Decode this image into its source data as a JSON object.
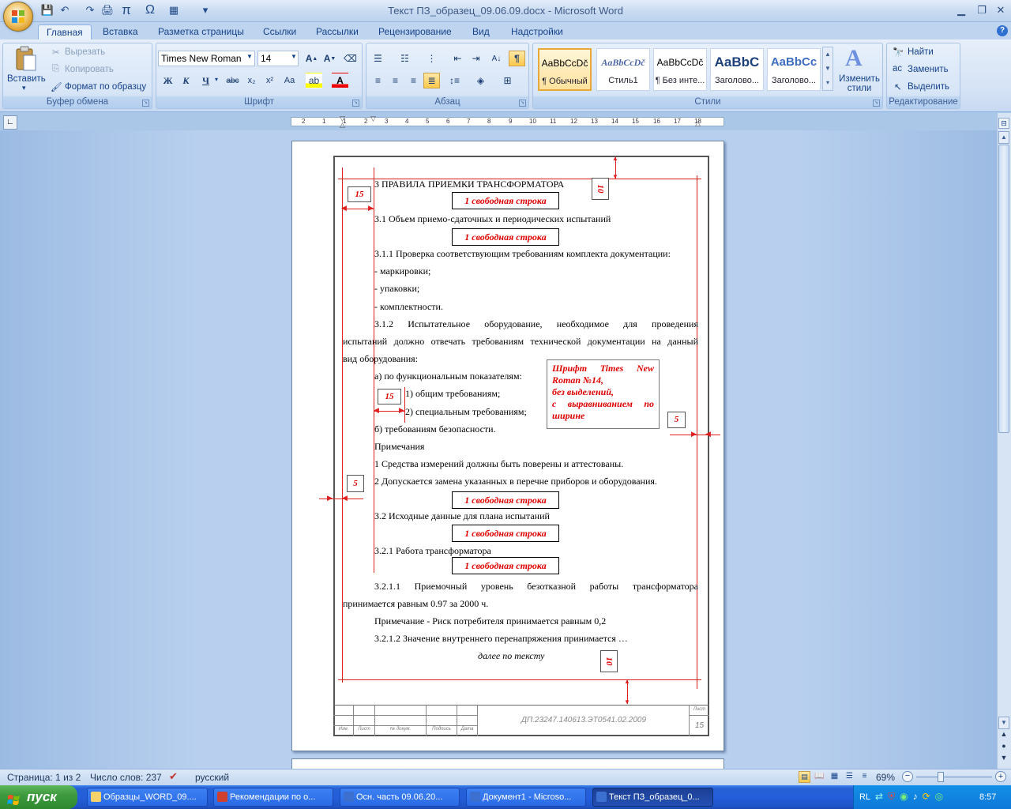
{
  "window": {
    "title": "Текст ПЗ_образец_09.06.09.docx - Microsoft Word"
  },
  "quick_access": [
    "save-icon",
    "undo-icon",
    "redo-icon",
    "print-icon",
    "pi-icon",
    "omega-icon",
    "table-icon",
    "customize-icon"
  ],
  "quick_access_glyphs": [
    "💾",
    "↶",
    "↷",
    "🖨",
    "π",
    "Ω",
    "▦",
    "▾"
  ],
  "tabs": [
    {
      "label": "Главная",
      "active": true
    },
    {
      "label": "Вставка"
    },
    {
      "label": "Разметка страницы"
    },
    {
      "label": "Ссылки"
    },
    {
      "label": "Рассылки"
    },
    {
      "label": "Рецензирование"
    },
    {
      "label": "Вид"
    },
    {
      "label": "Надстройки"
    }
  ],
  "clipboard": {
    "paste": "Вставить",
    "cut": "Вырезать",
    "copy": "Копировать",
    "format_painter": "Формат по образцу",
    "group": "Буфер обмена"
  },
  "font": {
    "name": "Times New Roman",
    "size": "14",
    "group": "Шрифт"
  },
  "paragraph": {
    "group": "Абзац"
  },
  "styles": {
    "items": [
      {
        "preview": "AaBbCcDč",
        "name": "¶ Обычный",
        "selected": true
      },
      {
        "preview": "AaBbCcDč",
        "name": "Стиль1"
      },
      {
        "preview": "AaBbCcDč",
        "name": "¶ Без инте..."
      },
      {
        "preview": "AaBbC",
        "name": "Заголово..."
      },
      {
        "preview": "AaBbCc",
        "name": "Заголово..."
      }
    ],
    "change": "Изменить стили",
    "group": "Стили"
  },
  "editing": {
    "find": "Найти",
    "replace": "Заменить",
    "select": "Выделить",
    "group": "Редактирование"
  },
  "ruler": {
    "ticks": [
      "2",
      "1",
      "1",
      "2",
      "3",
      "4",
      "5",
      "6",
      "7",
      "8",
      "9",
      "10",
      "11",
      "12",
      "13",
      "14",
      "15",
      "16",
      "17",
      "18"
    ]
  },
  "doc": {
    "heading": "3 ПРАВИЛА ПРИЕМКИ ТРАНСФОРМАТОРА",
    "free_line": "1 свободная строка",
    "s31": "3.1 Объем приемо-сдаточных и периодических испытаний",
    "s311": "3.1.1 Проверка соответствующим требованиям комплекта документации:",
    "l1": "- маркировки;",
    "l2": "- упаковки;",
    "l3": "- комплектности.",
    "s312_1": "3.1.2 Испытательное оборудование, необходимое для проведения",
    "s312_2": "испытаний должно отвечать требованиям технической документации на данный",
    "s312_3": "вид оборудования:",
    "a": "а) по функциональным показателям:",
    "a1": "1) общим требованиям;",
    "a2": "2) специальным требованиям;",
    "b": "б) требованиям безопасности.",
    "notes": "Примечания",
    "n1": "1 Средства измерений должны быть поверены и аттестованы.",
    "n2": "2 Допускается замена указанных в перечне приборов и оборудования.",
    "s32": "3.2 Исходные данные для плана испытаний",
    "s321": "3.2.1 Работа трансформатора",
    "s3211_1": "3.2.1.1 Приемочный уровень безотказной работы трансформатора",
    "s3211_2": "принимается равным 0.97 за 2000 ч.",
    "note2": "Примечание - Риск потребителя принимается равным 0,2",
    "s3212": "3.2.1.2 Значение внутреннего перенапряжения принимается …",
    "further": "далее по тексту",
    "font_note": [
      "Шрифт Times New",
      "Roman №14,",
      "без выделений,",
      "с выравниванием по",
      "ширине"
    ],
    "dims": {
      "d15a": "15",
      "d10a": "10",
      "d15b": "15",
      "d5a": "5",
      "d5b": "5",
      "d10b": "10"
    },
    "stamp": {
      "code": "ДП.23247.140613.ЭТ0541.02.2009",
      "sheet_label": "Лист",
      "sheet": "15",
      "cols": [
        "Изм.",
        "Лист",
        "№ докум.",
        "Подпись",
        "Дата"
      ]
    }
  },
  "status": {
    "page": "Страница: 1 из 2",
    "words": "Число слов: 237",
    "lang": "русский",
    "zoom": "69%"
  },
  "taskbar": {
    "start": "пуск",
    "items": [
      {
        "label": "Образцы_WORD_09...."
      },
      {
        "label": "Рекомендации по о..."
      },
      {
        "label": "Осн. часть 09.06.20..."
      },
      {
        "label": "Документ1 - Microso..."
      },
      {
        "label": "Текст ПЗ_образец_0...",
        "active": true
      }
    ],
    "lang": "RL",
    "clock": "8:57"
  }
}
